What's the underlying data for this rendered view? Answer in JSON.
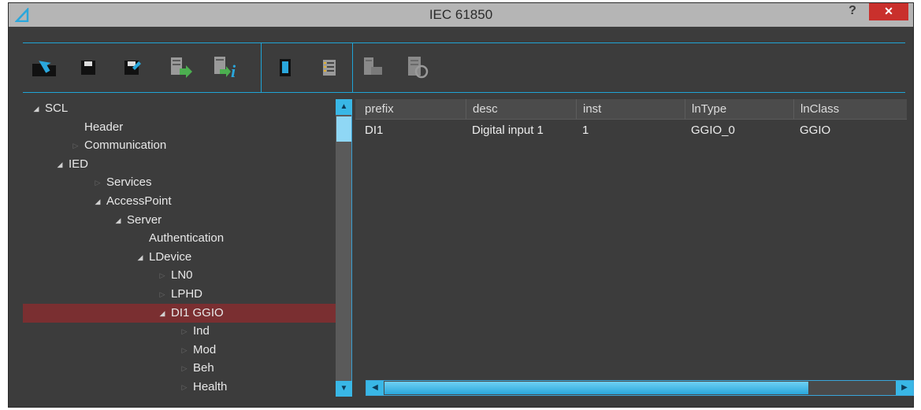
{
  "window": {
    "title": "IEC 61850",
    "help_label": "?",
    "close_label": "✕"
  },
  "toolbar": {
    "buttons": [
      {
        "name": "open-icon"
      },
      {
        "name": "save-icon"
      },
      {
        "name": "save-as-icon"
      },
      {
        "name": "import-icon"
      },
      {
        "name": "import-info-icon"
      },
      {
        "name": "device-icon"
      },
      {
        "name": "checklist-icon"
      },
      {
        "name": "export-disabled-icon"
      },
      {
        "name": "report-disabled-icon"
      }
    ]
  },
  "tree": {
    "items": [
      {
        "label": "SCL",
        "state": "expanded"
      },
      {
        "label": "Header",
        "state": "leaf"
      },
      {
        "label": "Communication",
        "state": "collapsed"
      },
      {
        "label": "IED",
        "state": "expanded"
      },
      {
        "label": "Services",
        "state": "collapsed"
      },
      {
        "label": "AccessPoint",
        "state": "expanded"
      },
      {
        "label": "Server",
        "state": "expanded"
      },
      {
        "label": "Authentication",
        "state": "leaf"
      },
      {
        "label": "LDevice",
        "state": "expanded"
      },
      {
        "label": "LN0",
        "state": "collapsed"
      },
      {
        "label": "LPHD",
        "state": "collapsed"
      },
      {
        "label": "DI1 GGIO",
        "state": "expanded",
        "selected": true
      },
      {
        "label": "Ind",
        "state": "collapsed"
      },
      {
        "label": "Mod",
        "state": "collapsed"
      },
      {
        "label": "Beh",
        "state": "collapsed"
      },
      {
        "label": "Health",
        "state": "collapsed"
      }
    ]
  },
  "grid": {
    "columns": [
      "prefix",
      "desc",
      "inst",
      "lnType",
      "lnClass"
    ],
    "column_labels": [
      "prefix",
      "desc",
      "inst",
      "lnType",
      "lnClass"
    ],
    "rows": [
      [
        "DI1",
        "Digital input 1",
        "1",
        "GGIO_0",
        "GGIO"
      ]
    ]
  },
  "colors": {
    "accent": "#1fa4d6",
    "selection": "#7a2f31",
    "background": "#3c3c3c",
    "close": "#c9302c"
  }
}
